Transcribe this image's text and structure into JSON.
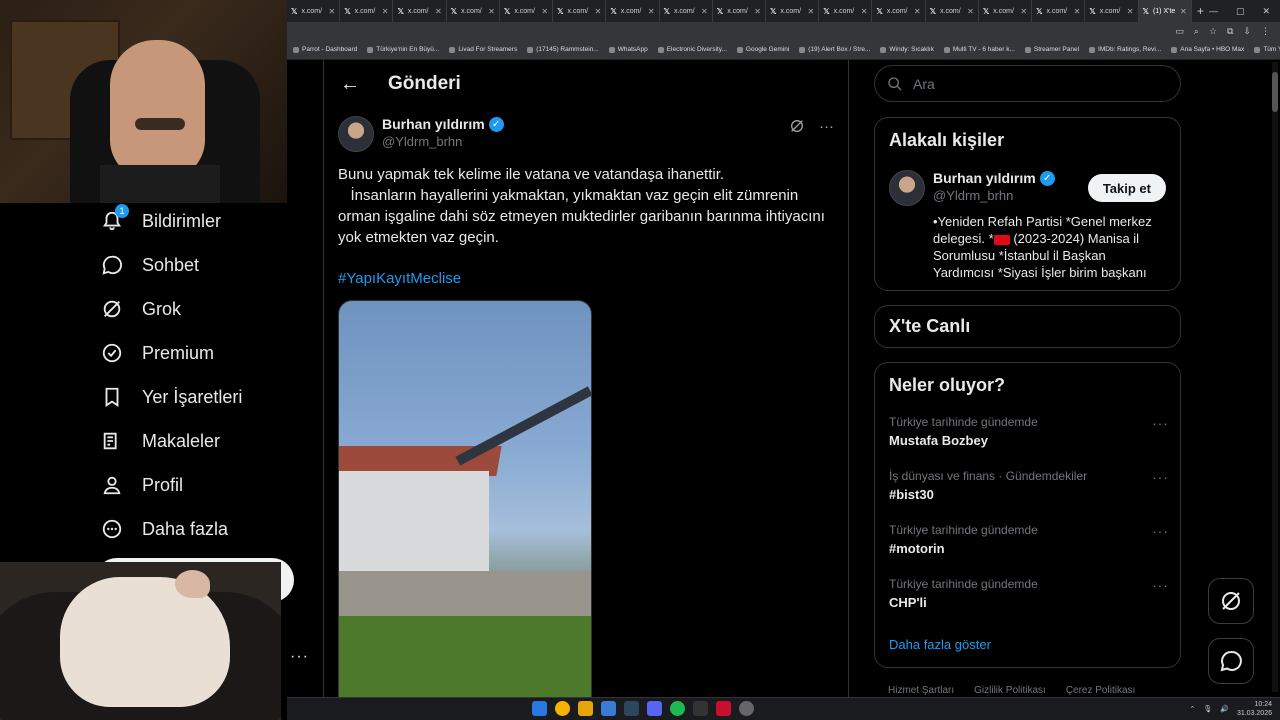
{
  "browser": {
    "tabs": [
      {
        "label": "x.com/"
      },
      {
        "label": "x.com/"
      },
      {
        "label": "x.com/"
      },
      {
        "label": "x.com/"
      },
      {
        "label": "x.com/"
      },
      {
        "label": "x.com/"
      },
      {
        "label": "x.com/"
      },
      {
        "label": "x.com/"
      },
      {
        "label": "x.com/"
      },
      {
        "label": "x.com/"
      },
      {
        "label": "x.com/"
      },
      {
        "label": "x.com/"
      },
      {
        "label": "x.com/"
      },
      {
        "label": "x.com/"
      },
      {
        "label": "x.com/"
      },
      {
        "label": "x.com/"
      }
    ],
    "active_tab": "(1) X'te",
    "bookmarks": [
      "Parrot - Dashboard",
      "Türkiye'nin En Büyü...",
      "Livad For Streamers",
      "(17145) Rammstein...",
      "WhatsApp",
      "Electronic Diversity...",
      "Google Gemini",
      "(19) Alert Box / Stre...",
      "Windy: Sıcaklık",
      "Multi TV - 6 haber k...",
      "Streamer Panel",
      "IMDb: Ratings, Revi...",
      "Ana Sayfa • HBO Max",
      "Tüm Yer İşaretleri"
    ]
  },
  "nav": {
    "notifications_label": "Bildirimler",
    "notifications_badge": "1",
    "chat_label": "Sohbet",
    "grok_label": "Grok",
    "premium_label": "Premium",
    "bookmarks_label": "Yer İşaretleri",
    "articles_label": "Makaleler",
    "profile_label": "Profil",
    "more_label": "Daha fazla",
    "account_more": "···"
  },
  "post": {
    "header_title": "Gönderi",
    "author_name": "Burhan yıldırım",
    "author_handle": "@Yldrm_brhn",
    "line1": "Bunu yapmak tek kelime ile vatana ve vatandaşa ihanettir.",
    "line2": "   İnsanların hayallerini yakmaktan, yıkmaktan vaz geçin elit zümrenin orman işgaline dahi söz etmeyen muktedirler garibanın barınma ihtiyacını yok etmekten vaz geçin.",
    "hashtag": "#YapıKayıtMeclise"
  },
  "sidebar": {
    "search_placeholder": "Ara",
    "related_title": "Alakalı kişiler",
    "related_name": "Burhan yıldırım",
    "related_handle": "@Yldrm_brhn",
    "follow_label": "Takip et",
    "bio_part1": "•Yeniden Refah Partisi *Genel merkez delegesi. *",
    "bio_part2": " (2023-2024) Manisa il Sorumlusu *İstanbul il Başkan Yardımcısı *Siyasi İşler birim başkanı",
    "live_title": "X'te Canlı",
    "trends_title": "Neler oluyor?",
    "trends": [
      {
        "context": "Türkiye tarihinde gündemde",
        "topic": "Mustafa Bozbey"
      },
      {
        "context": "İş dünyası ve finans · Gündemdekiler",
        "topic": "#bist30"
      },
      {
        "context": "Türkiye tarihinde gündemde",
        "topic": "#motorin"
      },
      {
        "context": "Türkiye tarihinde gündemde",
        "topic": "CHP'li"
      }
    ],
    "show_more": "Daha fazla göster",
    "footer": [
      "Hizmet Şartları",
      "Gizlilik Politikası",
      "Çerez Politikası"
    ]
  },
  "taskbar": {
    "time": "10:24",
    "date": "31.03.2026"
  },
  "colors": {
    "accent": "#1d9bf0",
    "background": "#000000",
    "border": "#2f3336",
    "muted": "#71767b"
  }
}
